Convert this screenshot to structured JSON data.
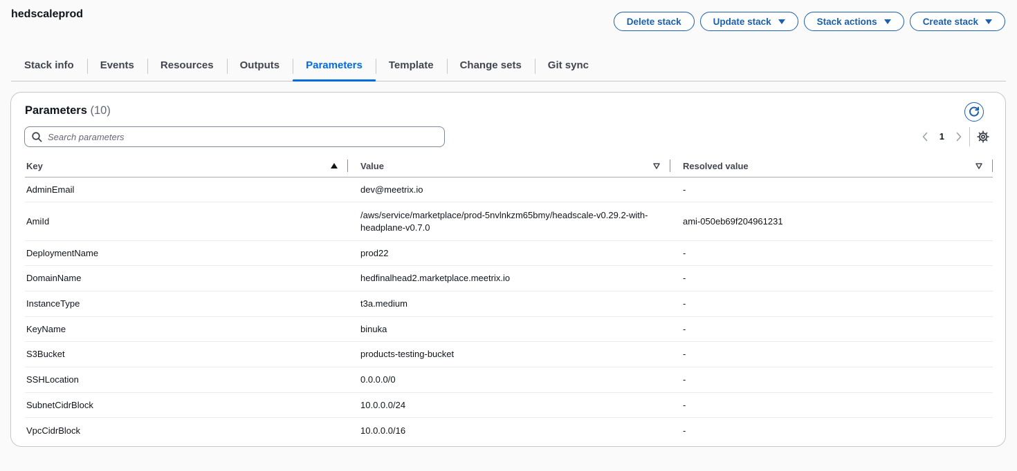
{
  "page_title": "hedscaleprod",
  "actions": {
    "delete": "Delete stack",
    "update": "Update stack",
    "stack_actions": "Stack actions",
    "create": "Create stack"
  },
  "tabs": [
    {
      "label": "Stack info"
    },
    {
      "label": "Events"
    },
    {
      "label": "Resources"
    },
    {
      "label": "Outputs"
    },
    {
      "label": "Parameters",
      "active": true
    },
    {
      "label": "Template"
    },
    {
      "label": "Change sets"
    },
    {
      "label": "Git sync"
    }
  ],
  "panel": {
    "title": "Parameters",
    "count": "(10)",
    "search_placeholder": "Search parameters",
    "page": "1"
  },
  "table": {
    "columns": [
      "Key",
      "Value",
      "Resolved value"
    ],
    "rows": [
      {
        "key": "AdminEmail",
        "value": "dev@meetrix.io",
        "resolved": "-"
      },
      {
        "key": "AmiId",
        "value": "/aws/service/marketplace/prod-5nvlnkzm65bmy/headscale-v0.29.2-with-headplane-v0.7.0",
        "resolved": "ami-050eb69f204961231"
      },
      {
        "key": "DeploymentName",
        "value": "prod22",
        "resolved": "-"
      },
      {
        "key": "DomainName",
        "value": "hedfinalhead2.marketplace.meetrix.io",
        "resolved": "-"
      },
      {
        "key": "InstanceType",
        "value": "t3a.medium",
        "resolved": "-"
      },
      {
        "key": "KeyName",
        "value": "binuka",
        "resolved": "-"
      },
      {
        "key": "S3Bucket",
        "value": "products-testing-bucket",
        "resolved": "-"
      },
      {
        "key": "SSHLocation",
        "value": "0.0.0.0/0",
        "resolved": "-"
      },
      {
        "key": "SubnetCidrBlock",
        "value": "10.0.0.0/24",
        "resolved": "-"
      },
      {
        "key": "VpcCidrBlock",
        "value": "10.0.0.0/16",
        "resolved": "-"
      }
    ]
  },
  "colors": {
    "accent": "#006ce0",
    "button_border": "#1b5fad",
    "text": "#0f141a",
    "muted": "#656871"
  }
}
